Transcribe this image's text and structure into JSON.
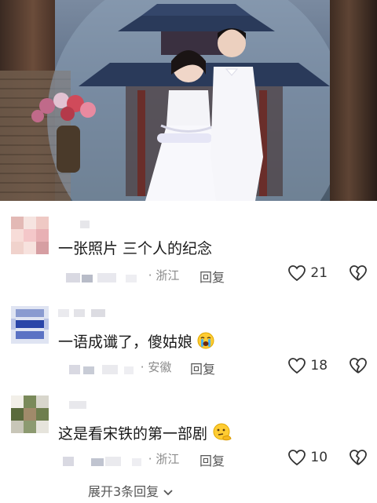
{
  "comments": [
    {
      "text": "一张照片 三个人的纪念",
      "location": "· 浙江",
      "reply_label": "回复",
      "likes": "21"
    },
    {
      "text": "一语成谶了，傻姑娘",
      "emoji_icon": "loudly-crying-face-icon",
      "location": "· 安徽",
      "reply_label": "回复",
      "likes": "18"
    },
    {
      "text": "这是看宋铁的第一部剧",
      "emoji_icon": "thinking-face-icon",
      "location": "· 浙江",
      "reply_label": "回复",
      "likes": "10"
    }
  ],
  "expand_label": "展开3条回复",
  "colors": {
    "heart": "#333333",
    "text": "#1a1a1a",
    "meta": "#8a8a8a"
  }
}
